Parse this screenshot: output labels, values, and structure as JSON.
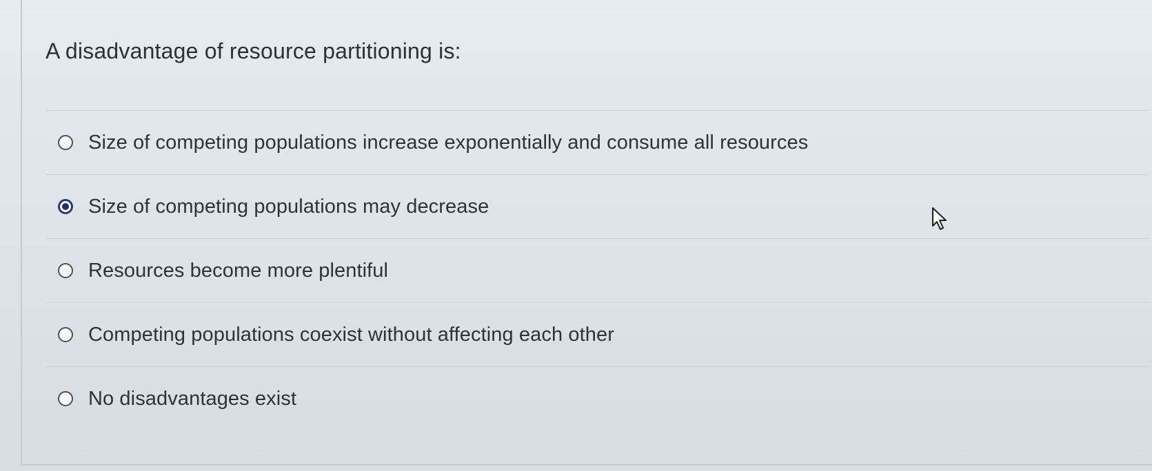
{
  "question": {
    "text": "A disadvantage of resource partitioning is:"
  },
  "options": [
    {
      "label": "Size of competing populations increase exponentially and consume all resources",
      "selected": false
    },
    {
      "label": "Size of competing populations may decrease",
      "selected": true
    },
    {
      "label": "Resources become more plentiful",
      "selected": false
    },
    {
      "label": "Competing populations coexist without affecting each other",
      "selected": false
    },
    {
      "label": "No disadvantages exist",
      "selected": false
    }
  ],
  "icons": {
    "cursor": "mouse-pointer-icon",
    "radio": "radio-button-icon"
  },
  "colors": {
    "background": "#dfe5ea",
    "text": "#2c3136",
    "radio_selected": "#1f2f5c",
    "divider": "#c9d0d6"
  }
}
